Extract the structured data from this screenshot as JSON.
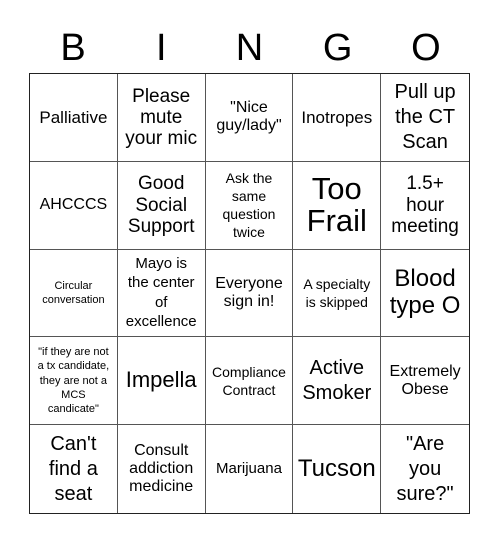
{
  "header": {
    "letters": [
      "B",
      "I",
      "N",
      "G",
      "O"
    ]
  },
  "cells": [
    "Palliative",
    "Please mute your mic",
    "\"Nice guy/lady\"",
    "Inotropes",
    "Pull up the CT Scan",
    "AHCCCS",
    "Good Social Support",
    "Ask the same question twice",
    "Too Frail",
    "1.5+ hour meeting",
    "Circular conversation",
    "Mayo is the center of excellence",
    "Everyone sign in!",
    "A specialty is skipped",
    "Blood type O",
    "\"if they are not a tx candidate, they are not a MCS candicate\"",
    "Impella",
    "Compliance Contract",
    "Active Smoker",
    "Extremely Obese",
    "Can't find a seat",
    "Consult addiction medicine",
    "Marijuana",
    "Tucson",
    "\"Are you sure?\""
  ]
}
